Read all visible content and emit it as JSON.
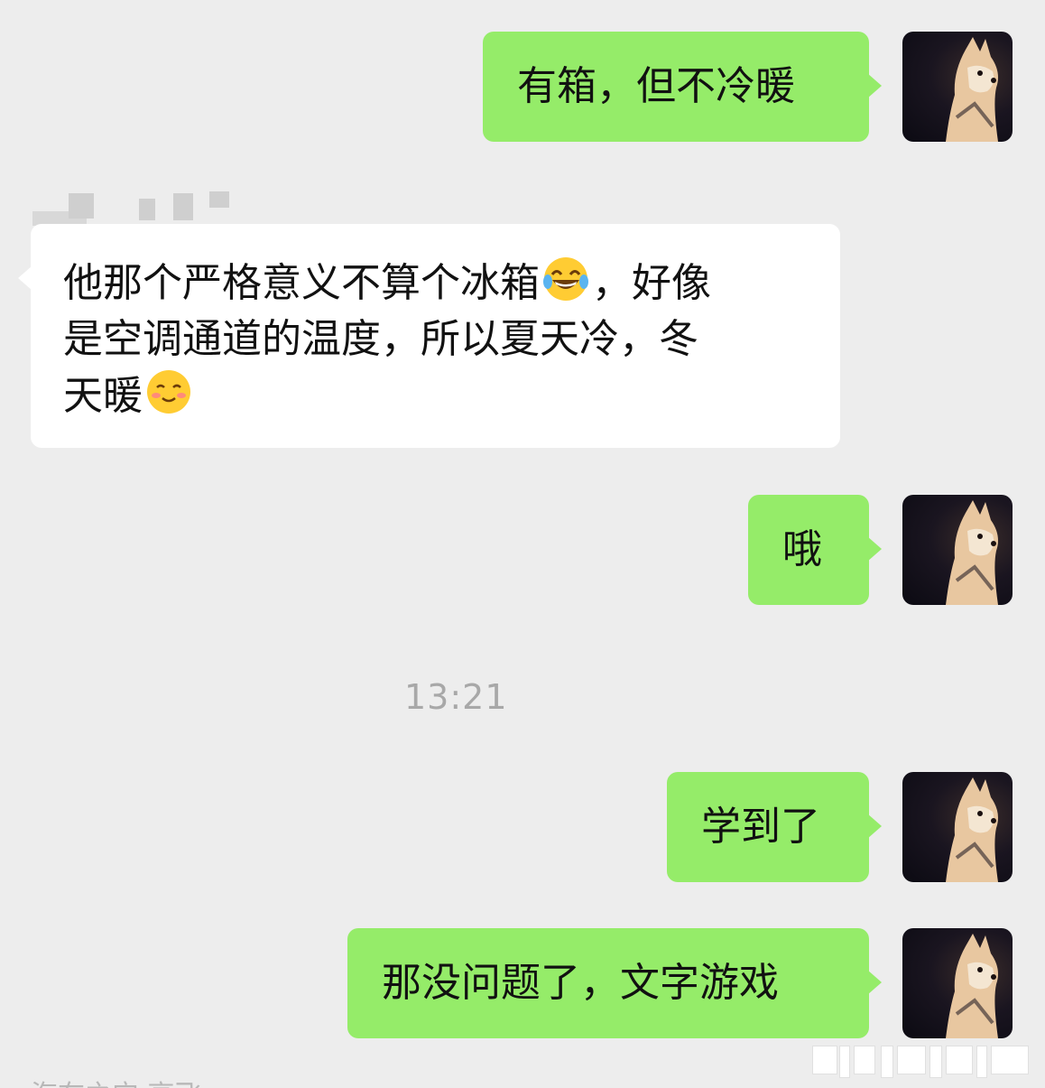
{
  "chat": {
    "timestamp": "13:21",
    "messages": [
      {
        "side": "right",
        "text": "有箱，但不冷暖"
      },
      {
        "side": "left",
        "line1_a": "他那个严格意义不算个冰箱",
        "line1_b": "，好像",
        "line2": "是空调通道的温度，所以夏天冷，冬",
        "line3": "天暖",
        "emoji1": "laughing-tears-emoji",
        "emoji2": "pleading-smile-emoji"
      },
      {
        "side": "right",
        "text": "哦"
      },
      {
        "side": "right",
        "text": "学到了"
      },
      {
        "side": "right",
        "text": "那没问题了，文字游戏"
      }
    ],
    "bottom_partial_text": "海布之宁 高飞"
  },
  "colors": {
    "background": "#ededed",
    "outgoing_bubble": "#95ec69",
    "incoming_bubble": "#ffffff",
    "timestamp": "#a8a8a8"
  }
}
